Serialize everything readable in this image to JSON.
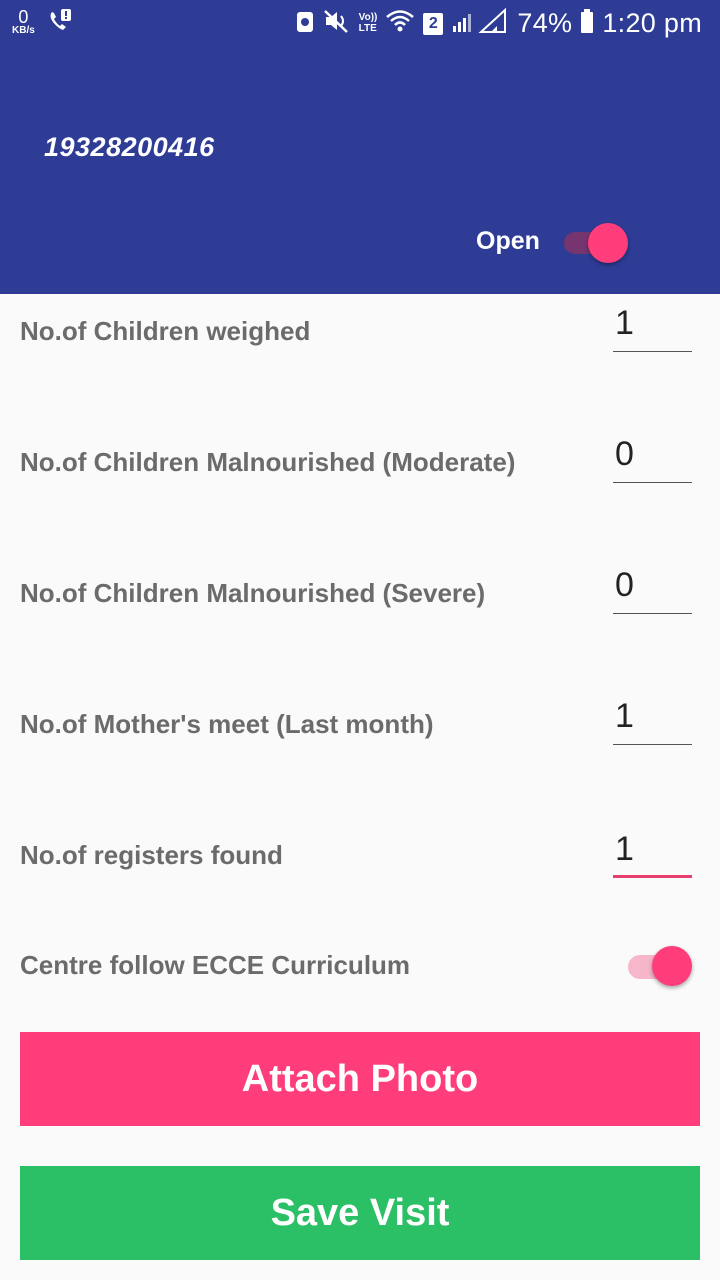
{
  "status_bar": {
    "kbs_value": "0",
    "kbs_unit": "KB/s",
    "volte_top": "Vo))",
    "volte_bottom": "LTE",
    "sim": "2",
    "battery": "74%",
    "time": "1:20 pm"
  },
  "header": {
    "centre_id": "19328200416",
    "open_label": "Open",
    "open_switch_on": true
  },
  "form": {
    "rows": [
      {
        "label": "No.of Children weighed",
        "value": "1"
      },
      {
        "label": "No.of Children Malnourished (Moderate)",
        "value": "0"
      },
      {
        "label": "No.of Children Malnourished (Severe)",
        "value": "0"
      },
      {
        "label": "No.of Mother's meet (Last month)",
        "value": "1"
      },
      {
        "label": "No.of registers found",
        "value": "1"
      }
    ],
    "ecce_label": "Centre follow ECCE Curriculum",
    "ecce_switch_on": true
  },
  "buttons": {
    "attach_photo": "Attach Photo",
    "save_visit": "Save Visit"
  },
  "colors": {
    "primary": "#2e3c96",
    "accent": "#ff3d7a",
    "save": "#2bbf66"
  }
}
